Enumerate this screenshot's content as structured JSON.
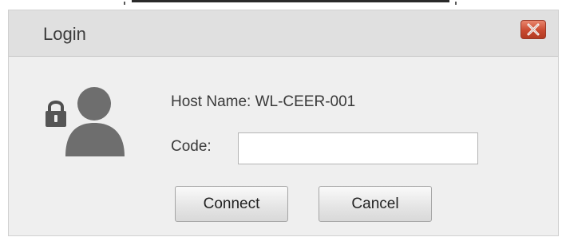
{
  "dialog": {
    "title": "Login",
    "close_icon": "close-x-icon",
    "user_icon": "locked-user-icon",
    "host_name_label": "Host Name: WL-CEER-001",
    "code_label": "Code:",
    "code_value": "",
    "connect_label": "Connect",
    "cancel_label": "Cancel"
  },
  "colors": {
    "close_button": "#c94a31",
    "icon_gray": "#6e6e6e"
  }
}
